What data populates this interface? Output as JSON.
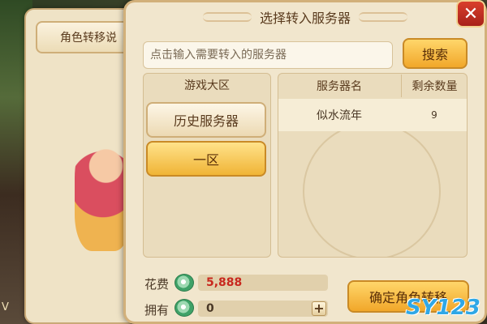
{
  "background": {
    "tab_label": "角色转移说",
    "edge_text": "V"
  },
  "dialog": {
    "title": "选择转入服务器",
    "close_icon": "✕"
  },
  "search": {
    "placeholder": "点击输入需要转入的服务器",
    "value": "",
    "button_label": "搜索"
  },
  "zones": {
    "header": "游戏大区",
    "items": [
      {
        "label": "历史服务器",
        "selected": false
      },
      {
        "label": "一区",
        "selected": true
      }
    ]
  },
  "servers": {
    "columns": [
      "服务器名",
      "剩余数量"
    ],
    "rows": [
      {
        "name": "似水流年",
        "count": "9"
      }
    ]
  },
  "cost": {
    "label": "花费",
    "value": "5,888",
    "icon": "jade-coin-icon"
  },
  "owned": {
    "label": "拥有",
    "value": "0",
    "icon": "jade-coin-icon",
    "plus_label": "+"
  },
  "confirm": {
    "label": "确定角色转移"
  },
  "watermark": {
    "text": "SY123"
  },
  "colors": {
    "accent_gold": "#f1a72a",
    "cost_red": "#c8281e",
    "panel_bg": "#f1e6cd",
    "close_red": "#c8281e"
  }
}
